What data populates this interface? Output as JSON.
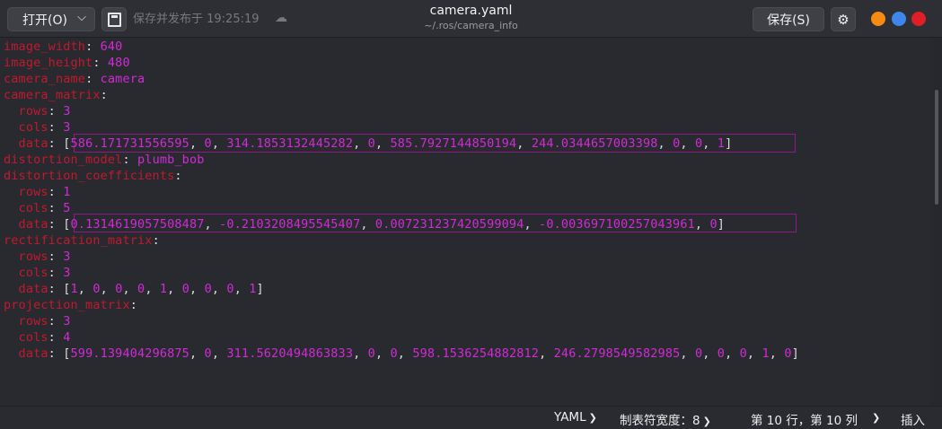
{
  "header": {
    "open_label": "打开(O)",
    "saved_status": "保存并发布于 19:25:19",
    "title": "camera.yaml",
    "subtitle": "~/.ros/camera_info",
    "save_label": "保存(S)"
  },
  "editor": {
    "lines": [
      {
        "key": "image_width",
        "value": "640"
      },
      {
        "key": "image_height",
        "value": "480"
      },
      {
        "key": "camera_name",
        "value": "camera"
      },
      {
        "key": "camera_matrix",
        "value": ""
      },
      {
        "key": "  rows",
        "value": "3"
      },
      {
        "key": "  cols",
        "value": "3"
      },
      {
        "key": "  data",
        "value": "[586.171731556595, 0, 314.1853132445282, 0, 585.7927144850194, 244.0344657003398, 0, 0, 1]"
      },
      {
        "key": "distortion_model",
        "value": "plumb_bob"
      },
      {
        "key": "distortion_coefficients",
        "value": ""
      },
      {
        "key": "  rows",
        "value": "1"
      },
      {
        "key": "  cols",
        "value": "5"
      },
      {
        "key": "  data",
        "value": "[0.1314619057508487, -0.2103208495545407, 0.007231237420599094, -0.003697100257043961, 0]"
      },
      {
        "key": "rectification_matrix",
        "value": ""
      },
      {
        "key": "  rows",
        "value": "3"
      },
      {
        "key": "  cols",
        "value": "3"
      },
      {
        "key": "  data",
        "value": "[1, 0, 0, 0, 1, 0, 0, 0, 1]"
      },
      {
        "key": "projection_matrix",
        "value": ""
      },
      {
        "key": "  rows",
        "value": "3"
      },
      {
        "key": "  cols",
        "value": "4"
      },
      {
        "key": "  data",
        "value": "[599.139404296875, 0, 311.5620494863833, 0, 0, 598.1536254882812, 246.2798549582985, 0, 0, 0, 1, 0]"
      }
    ]
  },
  "statusbar": {
    "language": "YAML",
    "tab_width": "制表符宽度：8",
    "cursor_position": "第 10 行，第 10 列",
    "insert_mode": "插入"
  }
}
